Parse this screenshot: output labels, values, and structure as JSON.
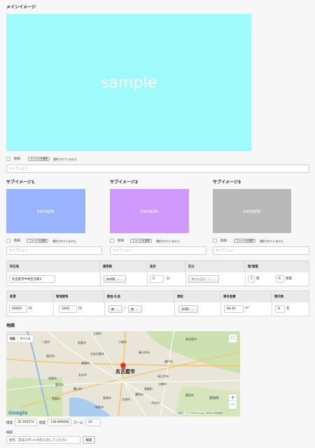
{
  "main_image": {
    "heading": "メインイメージ",
    "sample_text": "sample",
    "color": "#9ffbfb",
    "delete_label": "削除",
    "file_button": "ファイルを選択",
    "file_status": "選択されていません",
    "caption_placeholder": "キャプション"
  },
  "sub_images": [
    {
      "heading": "サブイメージ1",
      "sample_text": "sample",
      "color": "#99b3fd",
      "delete_label": "削除",
      "file_button": "ファイルを選択",
      "file_status": "選択されていません",
      "caption_placeholder": "キャプション"
    },
    {
      "heading": "サブイメージ2",
      "sample_text": "sample",
      "color": "#ce99fb",
      "delete_label": "削除",
      "file_button": "ファイルを選択",
      "file_status": "選択されていません",
      "caption_placeholder": "キャプション"
    },
    {
      "heading": "サブイメージ3",
      "sample_text": "sample",
      "color": "#b9b9b9",
      "delete_label": "削除",
      "file_button": "ファイルを選択",
      "file_status": "選択されていません",
      "caption_placeholder": "キャプション"
    }
  ],
  "property_table1": {
    "headers": [
      "所在地",
      "最寄駅",
      "徒歩",
      "区分",
      "階/階建"
    ],
    "address": "名古屋市中村区名駅3",
    "station": "あの駅",
    "walk_minutes": "5",
    "walk_unit": "分",
    "category": "マンション",
    "floor": "5",
    "floor_unit": "階",
    "stories": "6",
    "stories_unit": "階建"
  },
  "property_table2": {
    "headers": [
      "家賃",
      "管理費等",
      "敷金/礼金",
      "間取",
      "専有面積",
      "築年数"
    ],
    "rent": "60000",
    "rent_unit": "円",
    "fee": "5000",
    "fee_unit": "円",
    "deposit": "無",
    "key_money": "無",
    "slash": "/",
    "layout": "3LDK",
    "area": "80.45",
    "area_unit": "m²",
    "age": "8",
    "age_unit": "年"
  },
  "map": {
    "heading": "地図",
    "type_map": "地図",
    "type_satellite": "航空写真",
    "logo": "Google",
    "attribution": "地図データ ©2018 Google, ZENRIN   利用規約",
    "zoom_in": "+",
    "zoom_out": "−",
    "fullscreen": "⛶",
    "places": [
      "江南市",
      "小牧市",
      "一宮市",
      "岩倉市",
      "春日井市",
      "多治見市",
      "稲沢市",
      "北名古屋市",
      "清須市",
      "瀬戸市",
      "津島市",
      "あま市",
      "名古屋市",
      "長久手市",
      "愛西市",
      "日進市",
      "蟹江町",
      "東郷町",
      "豊明市",
      "弥富市",
      "豊田市",
      "東海市",
      "大府市",
      "知多市",
      "刈谷市",
      "愛知県"
    ]
  },
  "coords": {
    "lat_label": "緯度",
    "lat": "35.165574",
    "lng_label": "経度",
    "lng": "136.899066",
    "zoom_label": "ズーム",
    "zoom": "10"
  },
  "search": {
    "label": "検索",
    "placeholder": "住所、又はスポット名を入力してください",
    "button": "検索"
  }
}
